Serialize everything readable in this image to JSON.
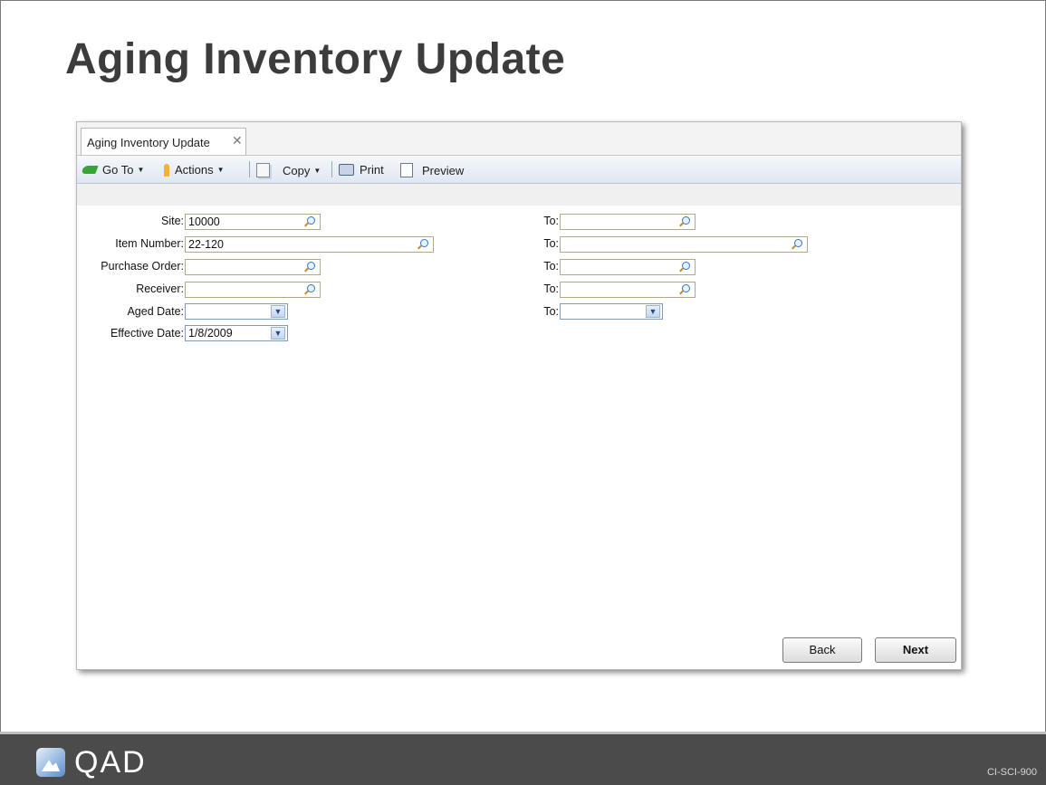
{
  "slide": {
    "title": "Aging Inventory Update",
    "doc_code": "CI-SCI-900",
    "logo_text": "QAD"
  },
  "window": {
    "tab": {
      "label": "Aging Inventory Update",
      "close_glyph": "✕"
    },
    "toolbar": {
      "goto_label": "Go To",
      "actions_label": "Actions",
      "copy_label": "Copy",
      "print_label": "Print",
      "preview_label": "Preview"
    },
    "form": {
      "site": {
        "label": "Site:",
        "value": "10000",
        "to_label": "To:",
        "to_value": ""
      },
      "item_number": {
        "label": "Item Number:",
        "value": "22-120",
        "to_label": "To:",
        "to_value": ""
      },
      "purchase_order": {
        "label": "Purchase Order:",
        "value": "",
        "to_label": "To:",
        "to_value": ""
      },
      "receiver": {
        "label": "Receiver:",
        "value": "",
        "to_label": "To:",
        "to_value": ""
      },
      "aged_date": {
        "label": "Aged Date:",
        "value": "",
        "to_label": "To:",
        "to_value": ""
      },
      "effective_date": {
        "label": "Effective Date:",
        "value": "1/8/2009"
      }
    },
    "buttons": {
      "back_label": "Back",
      "next_label": "Next"
    }
  }
}
